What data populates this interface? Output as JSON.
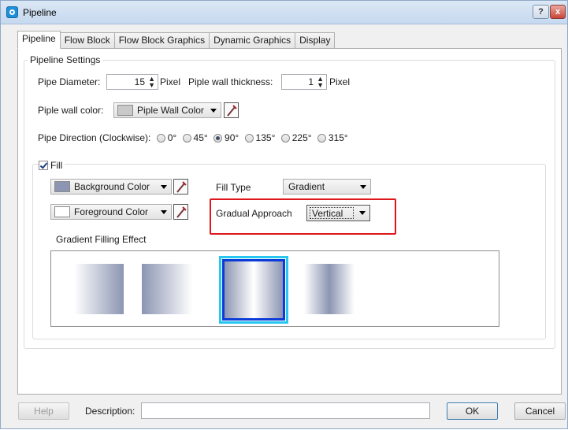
{
  "window": {
    "title": "Pipeline",
    "help_glyph": "?",
    "close_glyph": "x"
  },
  "tabs": [
    "Pipeline",
    "Flow Block",
    "Flow Block Graphics",
    "Dynamic Graphics",
    "Display"
  ],
  "active_tab": "Pipeline",
  "pipeline_settings": {
    "title": "Pipeline Settings",
    "diameter_label": "Pipe Diameter:",
    "diameter_value": "15",
    "diameter_unit": "Pixel",
    "wall_thickness_label": "Piple wall thickness:",
    "wall_thickness_value": "1",
    "wall_thickness_unit": "Pixel",
    "wall_color_label": "Piple wall color:",
    "wall_color_value": "Piple Wall Color",
    "wall_color_swatch": "#c9c9c9",
    "direction_label": "Pipe Direction (Clockwise):",
    "directions": [
      "0°",
      "45°",
      "90°",
      "135°",
      "225°",
      "315°"
    ],
    "direction_selected": "90°"
  },
  "fill": {
    "label": "Fill",
    "checked": true,
    "background_color_label": "Background Color",
    "background_swatch": "#8c95b2",
    "foreground_color_label": "Foreground Color",
    "foreground_swatch": "#ffffff",
    "fill_type_label": "Fill Type",
    "fill_type_value": "Gradient",
    "gradual_approach_label": "Gradual Approach",
    "gradual_approach_value": "Vertical",
    "gradient_effect_label": "Gradient Filling Effect",
    "gradient_selected_index": 3
  },
  "footer": {
    "help_label": "Help",
    "description_label": "Description:",
    "description_value": "",
    "ok_label": "OK",
    "cancel_label": "Cancel"
  },
  "colors": {
    "highlight": "#e0161d",
    "selected_outer": "#29c6f0",
    "selected_inner": "#0b3bd8"
  }
}
